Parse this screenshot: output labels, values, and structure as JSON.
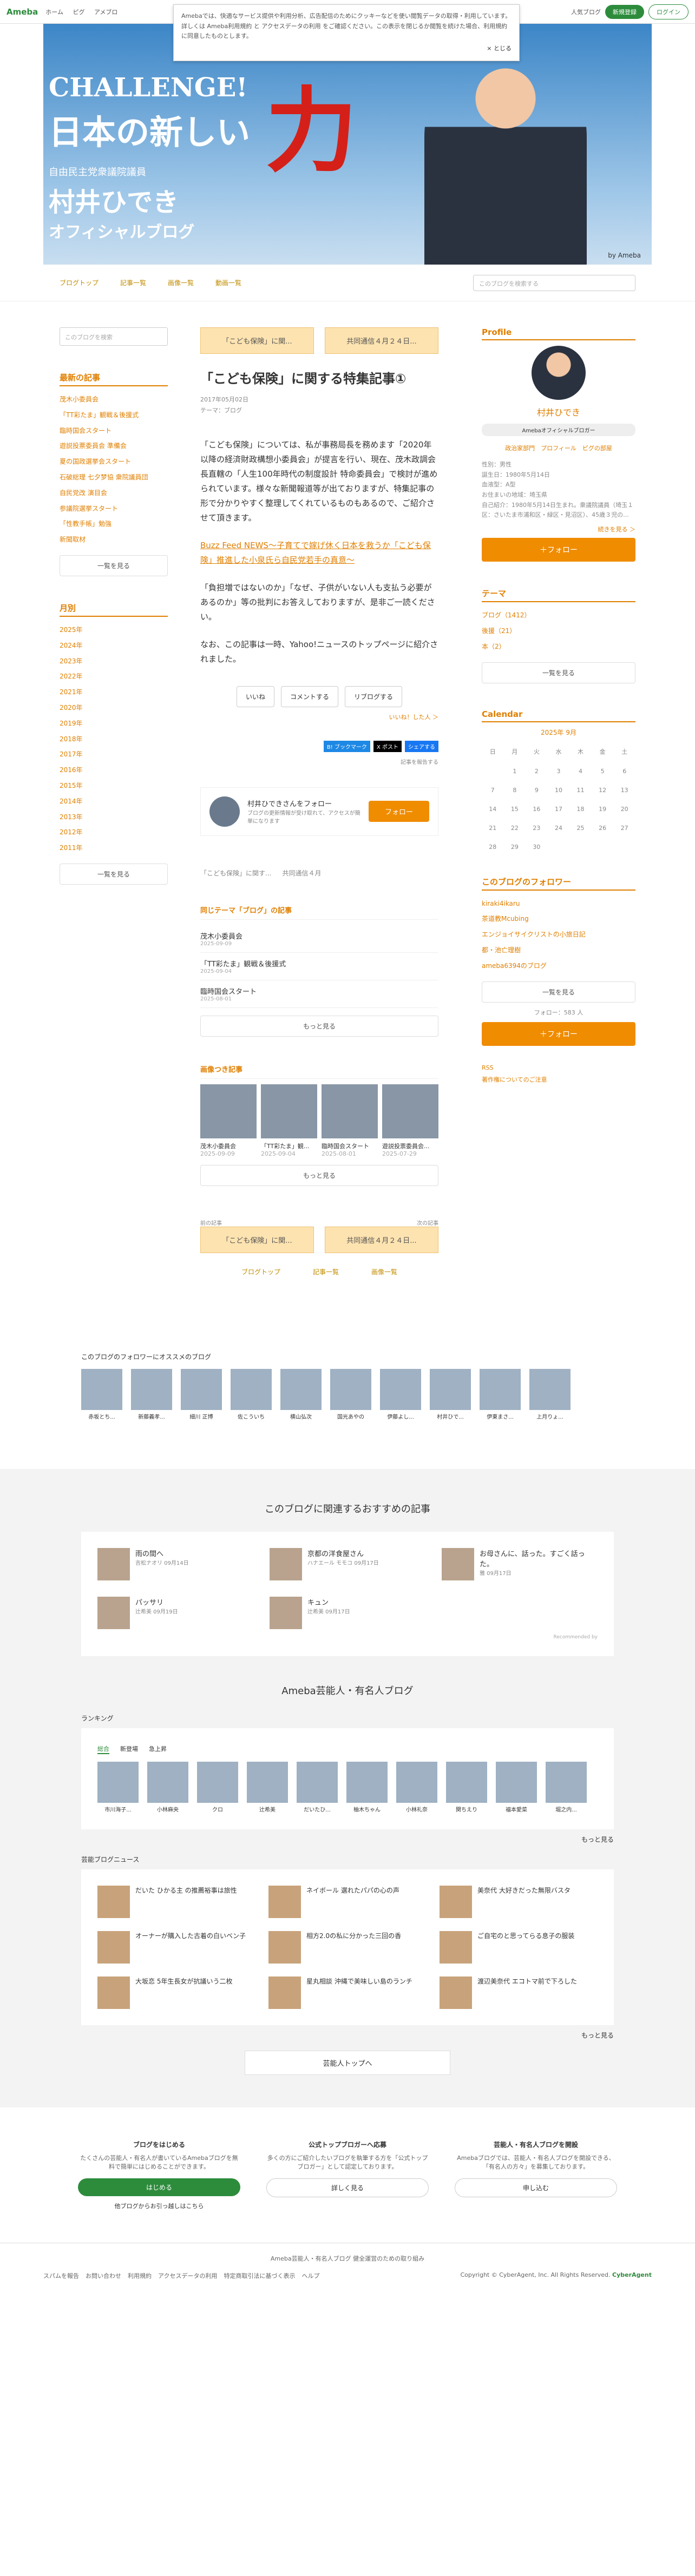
{
  "topbar": {
    "logo": "Ameba",
    "nav": [
      "ホーム",
      "ピグ",
      "アメブロ"
    ],
    "ranking": "人気ブログ",
    "signup": "新規登録",
    "login": "ログイン"
  },
  "cookie": {
    "text": "Amebaでは、快適なサービス提供や利用分析、広告配信のためにクッキーなどを使い閲覧データの取得・利用しています。詳しくは Ameba利用規約 と アクセスデータの利用 をご確認ください。この表示を閉じるか閲覧を続けた場合、利用規約に同意したものとします。",
    "close": "× とじる"
  },
  "hero": {
    "line1": "CHALLENGE!",
    "line2": "日本の新しい",
    "accent": "力",
    "party": "自由民主党衆議院議員",
    "name": "村井ひでき",
    "sub": "オフィシャルブログ",
    "brand": "by Ameba"
  },
  "subnav": {
    "items": [
      "ブログトップ",
      "記事一覧",
      "画像一覧",
      "動画一覧"
    ],
    "search": "このブログを検索する"
  },
  "left": {
    "search": "このブログを検索",
    "recent_title": "最新の記事",
    "recent": [
      "茂木小委員会",
      "「TT彩たま」観戦＆後援式",
      "臨時国会スタート",
      "遊説投票委員会 準備会",
      "夏の国政選挙会スタート",
      "石破総理 七夕梦協 衆院議員団",
      "自民党改 演目会",
      "参議院選挙スタート",
      "「性教手帳」勉強",
      "新聞取材"
    ],
    "more": "一覧を見る",
    "monthly_title": "月別",
    "years": [
      "2025年",
      "2024年",
      "2023年",
      "2022年",
      "2021年",
      "2020年",
      "2019年",
      "2018年",
      "2017年",
      "2016年",
      "2015年",
      "2014年",
      "2013年",
      "2012年",
      "2011年"
    ]
  },
  "article": {
    "prev": "「こども保険」に関...",
    "next": "共同通信４月２４日...",
    "title": "「こども保険」に関する特集記事①",
    "date": "2017年05月02日",
    "theme": "テーマ：ブログ",
    "p1": "「こども保険」については、私が事務局長を務めます「2020年以降の経済財政構想小委員会」が提言を行い、現在、茂木政調会長直轄の「人生100年時代の制度設計 特命委員会」で検討が進められています。様々な新聞報道等が出ておりますが、特集記事の形で分かりやすく整理してくれているものもあるので、ご紹介させて頂きます。",
    "link": "Buzz Feed NEWS～子育てで嫁げ休く日本を救うか「こども保険」推進した小泉氏ら自民党若手の真意～",
    "p2": "「負担増ではないのか」「なぜ、子供がいない人も支払う必要があるのか」等の批判にお答えしておりますが、是非ご一読ください。",
    "p3": "なお、この記事は一時、Yahoo!ニュースのトップページに紹介されました。",
    "like": "いいね",
    "comment": "コメントする",
    "reblog": "リブログする",
    "like_count": "いいね！した人 ＞",
    "bookmark": "B! ブックマーク",
    "post": "X ポスト",
    "share": "シェアする",
    "report": "記事を報告する"
  },
  "follow": {
    "title": "村井ひできさんをフォロー",
    "desc": "ブログの更新情報が受け取れて、アクセスが簡単になります",
    "button": "フォロー"
  },
  "nav2": {
    "prev": "「こども保険」に関す...",
    "next": "共同通信４月"
  },
  "same_theme": {
    "title": "同じテーマ「ブログ」の記事",
    "items": [
      {
        "t": "茂木小委員会",
        "d": "2025-09-09"
      },
      {
        "t": "「TT彩たま」観戦＆後援式",
        "d": "2025-09-04"
      },
      {
        "t": "臨時国会スタート",
        "d": "2025-08-01"
      }
    ],
    "more": "もっと見る"
  },
  "photo": {
    "title": "画像つき記事",
    "items": [
      {
        "t": "茂木小委員会",
        "d": "2025-09-09"
      },
      {
        "t": "「TT彩たま」観...",
        "d": "2025-09-04"
      },
      {
        "t": "臨時国会スタート",
        "d": "2025-08-01"
      },
      {
        "t": "遊説投票委員会...",
        "d": "2025-07-29"
      }
    ],
    "more": "もっと見る"
  },
  "bottom_nav": {
    "prev_label": "前の記事",
    "next_label": "次の記事",
    "prev": "「こども保険」に関...",
    "next": "共同通信４月２４日...",
    "items": [
      "ブログトップ",
      "記事一覧",
      "画像一覧"
    ]
  },
  "profile": {
    "title": "Profile",
    "name": "村井ひでき",
    "badge": "Amebaオフィシャルブロガー",
    "links": "政治家部門　プロフィール　ピグの部屋",
    "info": [
      "性別：男性",
      "誕生日：1980年5月14日",
      "血液型：A型",
      "お住まいの地域：埼玉県",
      "自己紹介：1980年5月14日生まれ。衆議院議員（埼玉１区：さいたま市浦和区・緑区・見沼区）、45歳３児の..."
    ],
    "more": "続きを見る ＞",
    "follow": "＋フォロー",
    "theme_title": "テーマ",
    "themes": [
      "ブログ（1412）",
      "後援（21）",
      "本（2）"
    ],
    "theme_more": "一覧を見る"
  },
  "calendar": {
    "title": "Calendar",
    "month": "2025年 9月",
    "days": [
      "日",
      "月",
      "火",
      "水",
      "木",
      "金",
      "土"
    ],
    "dates": [
      "",
      "1",
      "2",
      "3",
      "4",
      "5",
      "6",
      "7",
      "8",
      "9",
      "10",
      "11",
      "12",
      "13",
      "14",
      "15",
      "16",
      "17",
      "18",
      "19",
      "20",
      "21",
      "22",
      "23",
      "24",
      "25",
      "26",
      "27",
      "28",
      "29",
      "30",
      "",
      "",
      "",
      ""
    ]
  },
  "followers": {
    "title": "このブログのフォロワー",
    "list": [
      "kiraki4ikaru",
      "茶道教Mcubing",
      "エンジョイサイクリストの小旅日記",
      "都・池亡理樹",
      "ameba6394のブログ"
    ],
    "more": "一覧を見る",
    "count": "フォロー：583 人",
    "follow": "＋フォロー",
    "rss": "RSS",
    "report": "著作権についてのご注意"
  },
  "recommend": {
    "title": "このブログのフォロワーにオススメのブログ",
    "names": [
      "赤坂とち...",
      "新藤義孝...",
      "細川 正博",
      "佐こういち",
      "横山弘次",
      "国光あやの",
      "伊藤よし...",
      "村井ひで...",
      "伊東まさ...",
      "上月りょ..."
    ]
  },
  "related": {
    "title": "このブログに関連するおすすめの記事",
    "items": [
      {
        "t": "雨の間へ",
        "a": "吉松ナオリ 09月14日"
      },
      {
        "t": "京都の洋食屋さん",
        "a": "ハナエール モモコ 09月17日"
      },
      {
        "t": "お母さんに、話った。すごく話った。",
        "a": "雅 09月17日"
      },
      {
        "t": "パッサリ",
        "a": "辻希美 09月19日"
      },
      {
        "t": "キュン",
        "a": "辻希美 09月17日"
      }
    ],
    "powered": "Recommended by"
  },
  "celeb": {
    "title": "Ameba芸能人・有名人ブログ",
    "ranking": "ランキング",
    "tabs": [
      "総合",
      "新登場",
      "急上昇"
    ],
    "names": [
      "市川海子...",
      "小林麻央",
      "クロ",
      "辻希美",
      "だいたひ...",
      "柚木ちゃん",
      "小林礼奈",
      "関ちえり",
      "福本愛菜",
      "堀之内..."
    ],
    "more": "もっと見る",
    "news_title": "芸能ブログニュース",
    "news": [
      "だいた ひかる主 の推薦裕事は旅性",
      "ネイボール 選れたパパの心の声",
      "美奈代 大好きだった無限バスタ",
      "オーナーが購入した古着の白いベン子",
      "相方2.0の私に分かった三回の香",
      "ご自宅のと思ってらる息子の服装",
      "大坂恋 5年生長女が抗議いう二枚",
      "星丸相談 沖縄で美味しい島のランチ",
      "渡辺美奈代 エコトマ前で下ろした"
    ],
    "more2": "もっと見る",
    "top": "芸能人トップへ"
  },
  "footer": {
    "cols": [
      {
        "t": "ブログをはじめる",
        "d": "たくさんの芸能人・有名人が書いているAmebaブログを無料で簡単にはじめることができます。",
        "b": "はじめる",
        "s": "他ブログからお引っ越しはこちら"
      },
      {
        "t": "公式トップブロガーへ応募",
        "d": "多くの方にご紹介したいブログを執筆する方を「公式トップブロガー」として認定しております。",
        "b": "詳しく見る"
      },
      {
        "t": "芸能人・有名人ブログを開設",
        "d": "Amebaブログでは、芸能人・有名人ブログを開設できる、「有名人の方々」を募集しております。",
        "b": "申し込む"
      }
    ],
    "line1": "Ameba芸能人・有名人ブログ 健全運営のための取り組み",
    "links": [
      "スパムを報告",
      "お問い合わせ",
      "利用規約",
      "アクセスデータの利用",
      "特定商取引法に基づく表示",
      "ヘルプ"
    ],
    "copyright": "Copyright © CyberAgent, Inc. All Rights Reserved.",
    "ca": "CyberAgent"
  }
}
